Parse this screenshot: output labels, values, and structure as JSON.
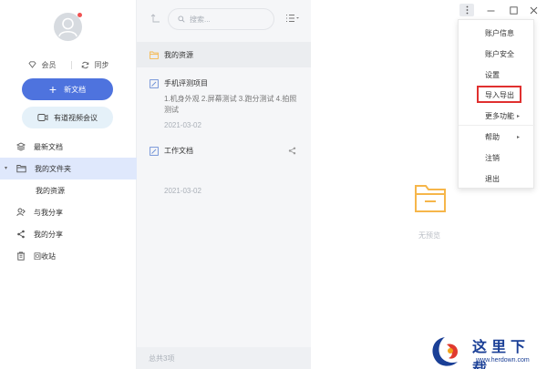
{
  "sidebar": {
    "member_label": "会员",
    "sync_label": "同步",
    "new_doc_label": "新文档",
    "meeting_label": "有道视频会议",
    "nav": {
      "recent": "最新文档",
      "my_folder": "我的文件夹",
      "my_resources": "我的资源",
      "shared_with_me": "与我分享",
      "my_shares": "我的分享",
      "recycle_bin": "回收站"
    }
  },
  "list": {
    "search_placeholder": "搜索...",
    "header_label": "我的资源",
    "docs": [
      {
        "title": "手机评测项目",
        "summary": "1.机身外观 2.屏幕测试 3.跑分测试 4.拍照测试",
        "date": "2021-03-02"
      },
      {
        "title": "工作文档",
        "summary": "",
        "date": "2021-03-02"
      }
    ],
    "footer": "总共3项"
  },
  "preview": {
    "empty_text": "无预览"
  },
  "menu": {
    "items": {
      "account_info": "账户信息",
      "account_security": "账户安全",
      "settings": "设置",
      "import_export": "导入导出",
      "more_features": "更多功能",
      "help": "帮助",
      "logout": "注销",
      "exit": "退出"
    }
  },
  "watermark": {
    "brand": "这里下载",
    "url": "www.herdown.com"
  },
  "colors": {
    "accent": "#4e73de",
    "highlight_box": "#e0302f",
    "folder_icon": "#f6b64a",
    "active_nav": "#dfe8fc"
  }
}
